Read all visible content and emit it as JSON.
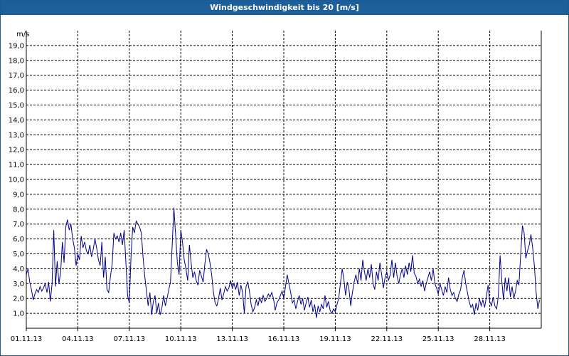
{
  "window": {
    "title": "Windgeschwindigkeit bis 20 [m/s]"
  },
  "colors": {
    "title_bg": "#1d5f9a",
    "series": "#00008b",
    "grid": "#000000"
  },
  "chart_data": {
    "type": "line",
    "ylabel": "m/s",
    "ylim": [
      0,
      20
    ],
    "y_ticks": [
      "1,0",
      "2,0",
      "3,0",
      "4,0",
      "5,0",
      "6,0",
      "7,0",
      "8,0",
      "9,0",
      "10,0",
      "11,0",
      "12,0",
      "13,0",
      "14,0",
      "15,0",
      "16,0",
      "17,0",
      "18,0",
      "19,0"
    ],
    "x_ticks": [
      "01.11.13",
      "04.11.13",
      "07.11.13",
      "10.11.13",
      "13.11.13",
      "16.11.13",
      "19.11.13",
      "22.11.13",
      "25.11.13",
      "28.11.13"
    ],
    "x_range": [
      "01.11.13",
      "01.12.13"
    ],
    "grid": true,
    "series": [
      {
        "values": [
          [
            0.0,
            3.6
          ],
          [
            0.1,
            4.0
          ],
          [
            0.2,
            3.1
          ],
          [
            0.3,
            2.6
          ],
          [
            0.4,
            1.9
          ],
          [
            0.5,
            2.3
          ],
          [
            0.6,
            2.6
          ],
          [
            0.7,
            2.4
          ],
          [
            0.8,
            2.8
          ],
          [
            0.9,
            2.5
          ],
          [
            1.0,
            2.7
          ],
          [
            1.1,
            3.0
          ],
          [
            1.2,
            2.4
          ],
          [
            1.3,
            3.1
          ],
          [
            1.4,
            1.8
          ],
          [
            1.5,
            3.0
          ],
          [
            1.6,
            6.6
          ],
          [
            1.7,
            2.8
          ],
          [
            1.8,
            4.5
          ],
          [
            1.9,
            3.0
          ],
          [
            2.0,
            3.8
          ],
          [
            2.1,
            5.8
          ],
          [
            2.2,
            4.4
          ],
          [
            2.3,
            6.8
          ],
          [
            2.4,
            7.3
          ],
          [
            2.5,
            6.6
          ],
          [
            2.6,
            7.0
          ],
          [
            2.7,
            6.0
          ],
          [
            2.8,
            5.4
          ],
          [
            2.9,
            4.2
          ],
          [
            3.0,
            5.0
          ],
          [
            3.1,
            4.6
          ],
          [
            3.2,
            6.2
          ],
          [
            3.3,
            5.4
          ],
          [
            3.4,
            5.8
          ],
          [
            3.5,
            5.2
          ],
          [
            3.6,
            5.0
          ],
          [
            3.7,
            5.6
          ],
          [
            3.8,
            4.8
          ],
          [
            3.9,
            5.3
          ],
          [
            4.0,
            6.0
          ],
          [
            4.1,
            5.4
          ],
          [
            4.2,
            4.6
          ],
          [
            4.3,
            4.2
          ],
          [
            4.4,
            5.8
          ],
          [
            4.5,
            3.4
          ],
          [
            4.6,
            4.8
          ],
          [
            4.7,
            2.6
          ],
          [
            4.8,
            2.4
          ],
          [
            4.9,
            3.5
          ],
          [
            5.0,
            4.3
          ],
          [
            5.1,
            6.4
          ],
          [
            5.2,
            6.0
          ],
          [
            5.3,
            6.2
          ],
          [
            5.4,
            5.8
          ],
          [
            5.5,
            6.4
          ],
          [
            5.6,
            5.6
          ],
          [
            5.7,
            6.6
          ],
          [
            5.8,
            4.4
          ],
          [
            5.9,
            2.2
          ],
          [
            6.0,
            1.7
          ],
          [
            6.1,
            4.8
          ],
          [
            6.2,
            6.8
          ],
          [
            6.3,
            6.4
          ],
          [
            6.4,
            7.2
          ],
          [
            6.5,
            7.0
          ],
          [
            6.6,
            6.8
          ],
          [
            6.7,
            6.4
          ],
          [
            6.8,
            4.8
          ],
          [
            6.9,
            3.5
          ],
          [
            7.0,
            2.5
          ],
          [
            7.1,
            1.5
          ],
          [
            7.2,
            2.4
          ],
          [
            7.3,
            0.9
          ],
          [
            7.4,
            1.8
          ],
          [
            7.5,
            2.2
          ],
          [
            7.6,
            1.0
          ],
          [
            7.7,
            1.7
          ],
          [
            7.8,
            0.9
          ],
          [
            7.9,
            1.4
          ],
          [
            8.0,
            2.2
          ],
          [
            8.1,
            1.5
          ],
          [
            8.2,
            2.0
          ],
          [
            8.3,
            2.6
          ],
          [
            8.4,
            3.1
          ],
          [
            8.5,
            5.6
          ],
          [
            8.6,
            8.1
          ],
          [
            8.7,
            6.2
          ],
          [
            8.8,
            4.4
          ],
          [
            8.9,
            3.6
          ],
          [
            9.0,
            6.6
          ],
          [
            9.1,
            5.8
          ],
          [
            9.2,
            4.6
          ],
          [
            9.3,
            4.0
          ],
          [
            9.4,
            3.2
          ],
          [
            9.5,
            5.6
          ],
          [
            9.6,
            4.4
          ],
          [
            9.7,
            3.4
          ],
          [
            9.8,
            3.8
          ],
          [
            9.9,
            3.2
          ],
          [
            10.0,
            2.9
          ],
          [
            10.1,
            3.9
          ],
          [
            10.2,
            3.5
          ],
          [
            10.3,
            3.1
          ],
          [
            10.4,
            4.3
          ],
          [
            10.5,
            5.3
          ],
          [
            10.6,
            5.0
          ],
          [
            10.7,
            4.4
          ],
          [
            10.8,
            3.6
          ],
          [
            10.9,
            2.4
          ],
          [
            11.0,
            1.7
          ],
          [
            11.1,
            1.5
          ],
          [
            11.2,
            2.0
          ],
          [
            11.3,
            2.7
          ],
          [
            11.4,
            1.9
          ],
          [
            11.5,
            2.3
          ],
          [
            11.6,
            2.8
          ],
          [
            11.7,
            2.5
          ],
          [
            11.8,
            2.7
          ],
          [
            11.9,
            3.2
          ],
          [
            12.0,
            2.7
          ],
          [
            12.1,
            3.0
          ],
          [
            12.2,
            2.6
          ],
          [
            12.3,
            3.1
          ],
          [
            12.4,
            2.2
          ],
          [
            12.5,
            2.9
          ],
          [
            12.6,
            2.4
          ],
          [
            12.7,
            1.0
          ],
          [
            12.8,
            2.8
          ],
          [
            12.9,
            3.1
          ],
          [
            13.0,
            2.5
          ],
          [
            13.1,
            1.6
          ],
          [
            13.2,
            1.1
          ],
          [
            13.3,
            1.4
          ],
          [
            13.4,
            1.9
          ],
          [
            13.5,
            1.5
          ],
          [
            13.6,
            2.1
          ],
          [
            13.7,
            1.7
          ],
          [
            13.8,
            2.2
          ],
          [
            13.9,
            1.8
          ],
          [
            14.0,
            2.0
          ],
          [
            14.1,
            2.3
          ],
          [
            14.2,
            2.1
          ],
          [
            14.3,
            2.4
          ],
          [
            14.4,
            2.0
          ],
          [
            14.5,
            1.2
          ],
          [
            14.6,
            1.7
          ],
          [
            14.7,
            1.9
          ],
          [
            14.8,
            2.2
          ],
          [
            14.9,
            2.5
          ],
          [
            15.0,
            2.0
          ],
          [
            15.1,
            2.8
          ],
          [
            15.2,
            3.6
          ],
          [
            15.3,
            3.0
          ],
          [
            15.4,
            2.4
          ],
          [
            15.5,
            1.7
          ],
          [
            15.6,
            1.9
          ],
          [
            15.7,
            1.3
          ],
          [
            15.8,
            1.8
          ],
          [
            15.9,
            2.2
          ],
          [
            16.0,
            1.6
          ],
          [
            16.1,
            2.0
          ],
          [
            16.2,
            1.2
          ],
          [
            16.3,
            1.7
          ],
          [
            16.4,
            2.1
          ],
          [
            16.5,
            1.4
          ],
          [
            16.6,
            1.9
          ],
          [
            16.7,
            1.1
          ],
          [
            16.8,
            1.6
          ],
          [
            16.9,
            0.7
          ],
          [
            17.0,
            1.5
          ],
          [
            17.1,
            1.1
          ],
          [
            17.2,
            1.6
          ],
          [
            17.3,
            1.3
          ],
          [
            17.4,
            2.2
          ],
          [
            17.5,
            1.4
          ],
          [
            17.6,
            1.8
          ],
          [
            17.7,
            1.2
          ],
          [
            17.8,
            1.0
          ],
          [
            17.9,
            1.3
          ],
          [
            18.0,
            1.1
          ],
          [
            18.1,
            1.6
          ],
          [
            18.2,
            2.0
          ],
          [
            18.3,
            3.0
          ],
          [
            18.4,
            4.0
          ],
          [
            18.5,
            3.3
          ],
          [
            18.6,
            2.2
          ],
          [
            18.7,
            3.1
          ],
          [
            18.8,
            2.6
          ],
          [
            18.9,
            1.5
          ],
          [
            19.0,
            2.4
          ],
          [
            19.1,
            3.1
          ],
          [
            19.2,
            3.6
          ],
          [
            19.3,
            3.0
          ],
          [
            19.4,
            4.0
          ],
          [
            19.5,
            3.2
          ],
          [
            19.6,
            4.6
          ],
          [
            19.7,
            3.8
          ],
          [
            19.8,
            3.2
          ],
          [
            19.9,
            4.0
          ],
          [
            20.0,
            3.4
          ],
          [
            20.1,
            4.3
          ],
          [
            20.2,
            3.0
          ],
          [
            20.3,
            2.6
          ],
          [
            20.4,
            3.8
          ],
          [
            20.5,
            3.2
          ],
          [
            20.6,
            4.4
          ],
          [
            20.7,
            3.6
          ],
          [
            20.8,
            2.7
          ],
          [
            20.9,
            3.4
          ],
          [
            21.0,
            3.8
          ],
          [
            21.1,
            3.2
          ],
          [
            21.2,
            3.6
          ],
          [
            21.3,
            4.6
          ],
          [
            21.4,
            3.4
          ],
          [
            21.5,
            4.4
          ],
          [
            21.6,
            3.5
          ],
          [
            21.7,
            3.0
          ],
          [
            21.8,
            3.6
          ],
          [
            21.9,
            4.0
          ],
          [
            22.0,
            3.4
          ],
          [
            22.1,
            4.2
          ],
          [
            22.2,
            3.6
          ],
          [
            22.3,
            4.4
          ],
          [
            22.4,
            3.8
          ],
          [
            22.5,
            4.9
          ],
          [
            22.6,
            3.7
          ],
          [
            22.7,
            3.5
          ],
          [
            22.8,
            3.0
          ],
          [
            22.9,
            3.3
          ],
          [
            23.0,
            2.8
          ],
          [
            23.1,
            3.2
          ],
          [
            23.2,
            2.5
          ],
          [
            23.3,
            3.0
          ],
          [
            23.4,
            3.4
          ],
          [
            23.5,
            3.8
          ],
          [
            23.6,
            3.2
          ],
          [
            23.7,
            4.0
          ],
          [
            23.8,
            3.0
          ],
          [
            23.9,
            2.7
          ],
          [
            24.0,
            2.3
          ],
          [
            24.1,
            3.0
          ],
          [
            24.2,
            2.6
          ],
          [
            24.3,
            2.2
          ],
          [
            24.4,
            2.8
          ],
          [
            24.5,
            2.4
          ],
          [
            24.6,
            3.4
          ],
          [
            24.7,
            2.6
          ],
          [
            24.8,
            2.2
          ],
          [
            24.9,
            2.4
          ],
          [
            25.0,
            2.0
          ],
          [
            25.1,
            1.8
          ],
          [
            25.2,
            2.3
          ],
          [
            25.3,
            2.6
          ],
          [
            25.4,
            3.4
          ],
          [
            25.5,
            3.9
          ],
          [
            25.6,
            3.0
          ],
          [
            25.7,
            2.4
          ],
          [
            25.8,
            1.8
          ],
          [
            25.9,
            1.4
          ],
          [
            26.0,
            1.6
          ],
          [
            26.1,
            0.9
          ],
          [
            26.2,
            1.7
          ],
          [
            26.3,
            1.2
          ],
          [
            26.4,
            2.0
          ],
          [
            26.5,
            1.5
          ],
          [
            26.6,
            1.9
          ],
          [
            26.7,
            1.4
          ],
          [
            26.8,
            2.1
          ],
          [
            26.9,
            2.9
          ],
          [
            27.0,
            1.8
          ],
          [
            27.1,
            1.5
          ],
          [
            27.2,
            2.1
          ],
          [
            27.3,
            1.5
          ],
          [
            27.4,
            1.3
          ],
          [
            27.5,
            2.2
          ],
          [
            27.6,
            4.9
          ],
          [
            27.7,
            3.2
          ],
          [
            27.8,
            1.9
          ],
          [
            27.9,
            3.4
          ],
          [
            28.0,
            2.5
          ],
          [
            28.1,
            3.4
          ],
          [
            28.2,
            2.1
          ],
          [
            28.3,
            2.8
          ],
          [
            28.4,
            2.0
          ],
          [
            28.5,
            2.5
          ],
          [
            28.6,
            3.2
          ],
          [
            28.7,
            2.9
          ],
          [
            28.8,
            4.9
          ],
          [
            28.9,
            6.9
          ],
          [
            29.0,
            6.4
          ],
          [
            29.1,
            4.7
          ],
          [
            29.2,
            5.2
          ],
          [
            29.3,
            5.6
          ],
          [
            29.4,
            6.3
          ],
          [
            29.5,
            5.4
          ],
          [
            29.6,
            4.2
          ],
          [
            29.7,
            2.4
          ],
          [
            29.8,
            1.3
          ],
          [
            29.9,
            1.9
          ]
        ]
      }
    ]
  }
}
